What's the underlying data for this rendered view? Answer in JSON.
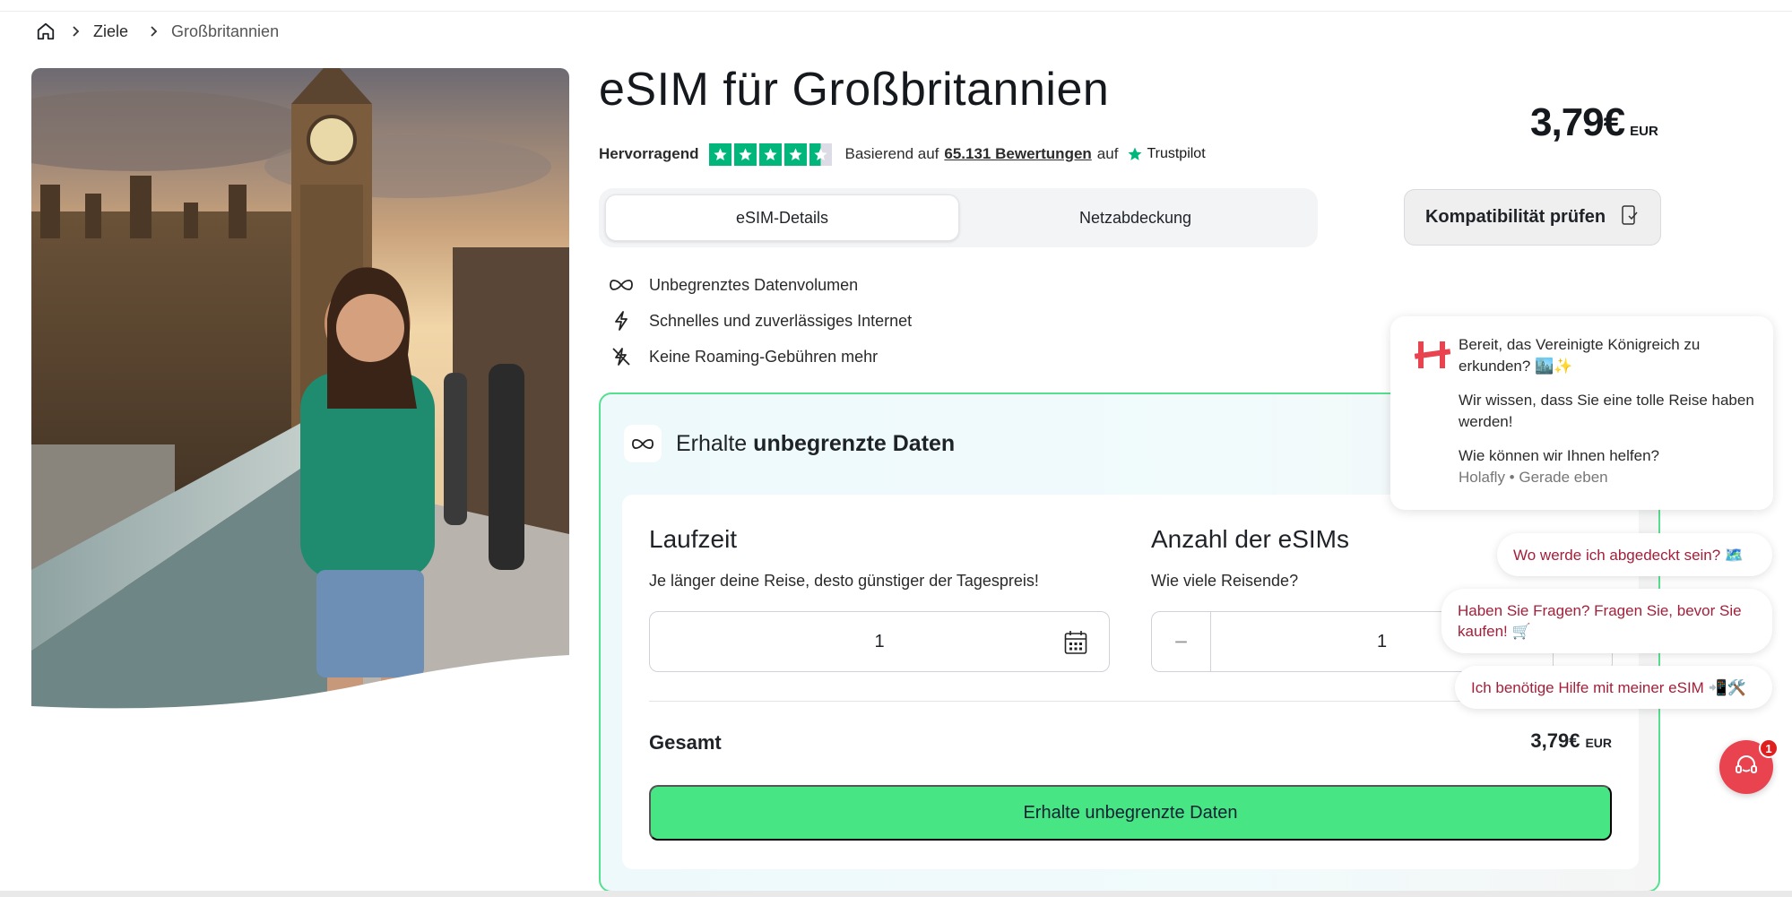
{
  "breadcrumb": {
    "items": [
      "Ziele",
      "Großbritannien"
    ]
  },
  "product": {
    "title": "eSIM für Großbritannien",
    "price": "3,79€",
    "currency": "EUR"
  },
  "rating": {
    "label": "Hervorragend",
    "stars": 4.5,
    "text_before": "Basierend auf",
    "reviews_link": "65.131 Bewertungen",
    "text_after": "auf",
    "provider": "Trustpilot",
    "star_color": "#00b67a"
  },
  "tabs": [
    {
      "label": "eSIM-Details",
      "active": true
    },
    {
      "label": "Netzabdeckung",
      "active": false
    }
  ],
  "compatibility_button": "Kompatibilität prüfen",
  "features": [
    {
      "icon": "infinity-icon",
      "label": "Unbegrenztes Datenvolumen"
    },
    {
      "icon": "lightning-icon",
      "label": "Schnelles und zuverlässiges Internet"
    },
    {
      "icon": "no-roaming-icon",
      "label": "Keine Roaming-Gebühren mehr"
    }
  ],
  "card": {
    "heading_prefix": "Erhalte",
    "heading_bold": "unbegrenzte Daten",
    "duration": {
      "title": "Laufzeit",
      "subtitle": "Je länger deine Reise, desto günstiger der Tagespreis!",
      "value": "1"
    },
    "quantity": {
      "title": "Anzahl der eSIMs",
      "subtitle": "Wie viele Reisende?",
      "value": "1"
    },
    "total_label": "Gesamt",
    "total_price": "3,79€",
    "total_currency": "EUR",
    "cta_label": "Erhalte unbegrenzte Daten",
    "accent_color": "#48e584"
  },
  "chat": {
    "greeting": "Bereit, das Vereinigte Königreich zu erkunden? 🏙️✨",
    "message2": "Wir wissen, dass Sie eine tolle Reise haben werden!",
    "message3": "Wie können wir Ihnen helfen?",
    "meta": "Holafly • Gerade eben",
    "quick_replies": [
      "Wo werde ich abgedeckt sein? 🗺️",
      "Haben Sie Fragen? Fragen Sie, bevor Sie kaufen! 🛒",
      "Ich benötige Hilfe mit meiner eSIM 📲🛠️"
    ],
    "unread_count": "1"
  }
}
